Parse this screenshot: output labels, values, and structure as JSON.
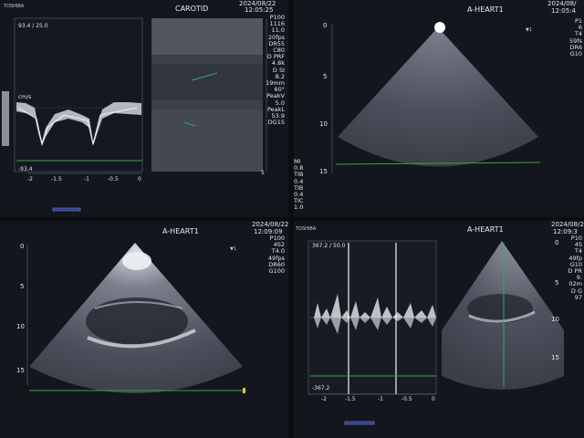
{
  "q1": {
    "brand": "TOSHIBA",
    "title": "CAROTID",
    "date": "2024/08/22",
    "time": "12:05:25",
    "doppler_scale": "93.4 / 25.0",
    "unit": "cm/s",
    "neg_scale": "-93.4",
    "xticks": [
      "-2",
      "-1.5",
      "-1",
      "-0.5",
      "0"
    ],
    "params": [
      "P100",
      "1116",
      "11.0",
      "20fps",
      "DR55",
      "C80",
      "D PRF",
      "4.8k",
      "D SI",
      "8.2",
      "19mm",
      "60°",
      "PeakV",
      "5.0",
      "PeakL",
      "53.9",
      "DG15"
    ],
    "depth_marks": [
      "5"
    ]
  },
  "q2": {
    "title": "A-HEART1",
    "date": "2024/08/",
    "time": "12:05:4",
    "params": [
      "P1",
      "6",
      "T4",
      "59fs",
      "DR6",
      "G10"
    ],
    "depth_marks": [
      "0",
      "5",
      "10",
      "15"
    ],
    "side_labels": [
      "MI",
      "0.8",
      "TIB",
      "0.4",
      "TIB",
      "0.4",
      "TIC",
      "1.0"
    ]
  },
  "q3": {
    "title": "A-HEART1",
    "date": "2024/08/22",
    "time": "12:09:09",
    "params": [
      "P100",
      "4S2",
      "T4.0",
      "49fps",
      "DR60",
      "G100"
    ],
    "depth_marks": [
      "0",
      "5",
      "10",
      "15"
    ]
  },
  "q4": {
    "brand": "TOSHIBA",
    "title": "A-HEART1",
    "date": "2024/08/2",
    "time": "12:09:3",
    "doppler_scale": "367.2 / 50.0",
    "neg_scale": "-367.2",
    "xticks": [
      "-2",
      "-1.5",
      "-1",
      "-0.5",
      "0"
    ],
    "params": [
      "P10",
      "4S",
      "T4",
      "49fp",
      "G10",
      "D PR",
      "9.",
      "02m",
      "D G",
      "97"
    ],
    "depth_marks": [
      "0",
      "5",
      "10",
      "15"
    ]
  }
}
